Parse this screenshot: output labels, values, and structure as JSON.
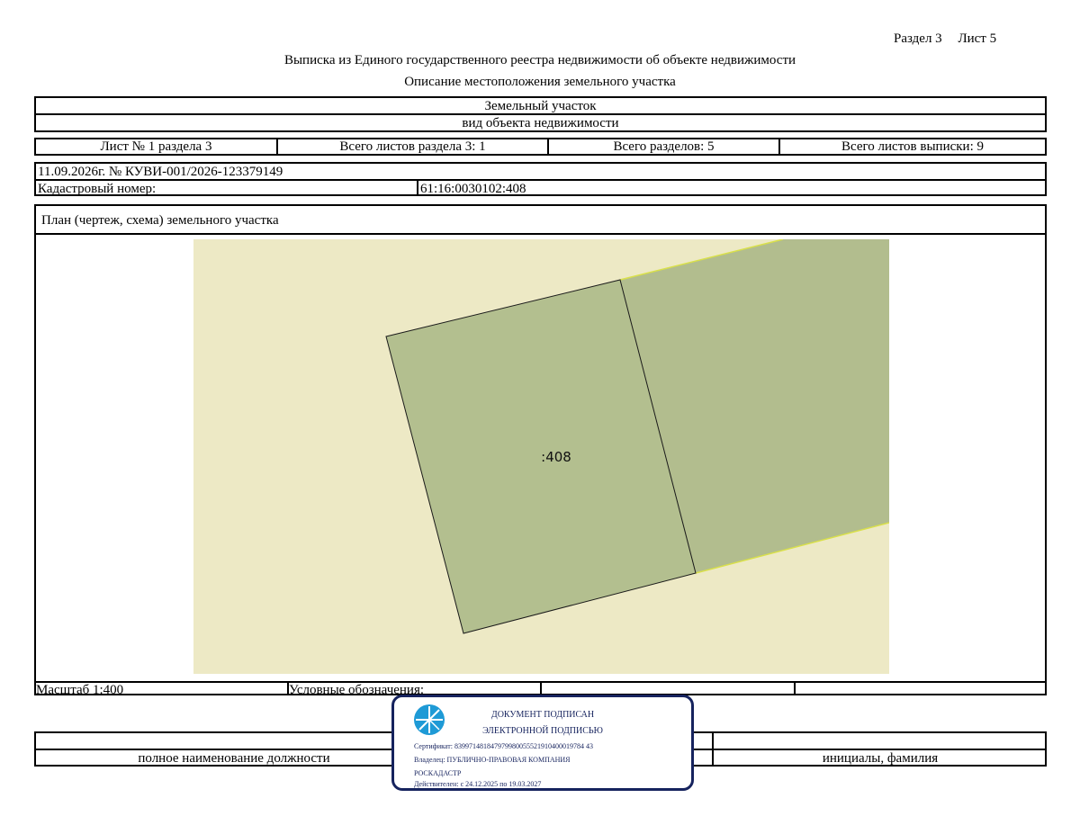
{
  "header": {
    "section_ref": "Раздел 3",
    "sheet_ref": "Лист 5",
    "title": "Выписка из Единого государственного реестра недвижимости об объекте недвижимости",
    "subtitle": "Описание местоположения земельного участка"
  },
  "object": {
    "type_value": "Земельный участок",
    "type_caption": "вид объекта недвижимости"
  },
  "sheet_info": {
    "sheet_no": "Лист № 1 раздела 3",
    "total_sheets_section": "Всего листов раздела 3: 1",
    "total_sections": "Всего разделов: 5",
    "total_sheets_extract": "Всего листов выписки: 9"
  },
  "record": {
    "date_number": "11.09.2026г. № КУВИ-001/2026-123379149",
    "cadastral_label": "Кадастровый номер:",
    "cadastral_value": "61:16:0030102:408"
  },
  "plan": {
    "title": "План (чертеж, схема) земельного участка",
    "parcel_label": ":408",
    "colors": {
      "background": "#ede9c5",
      "parcel_fill": "#b3bf8f",
      "neighbor_fill": "#b2bd8e",
      "neighbor_edge": "#d9e04a",
      "parcel_stroke": "#1a1a1a"
    }
  },
  "legend": {
    "scale": "Масштаб 1:400",
    "legend_label": "Условные обозначения:"
  },
  "signature": {
    "position_caption": "полное наименование должности",
    "name_caption": "инициалы, фамилия"
  },
  "stamp": {
    "line1": "ДОКУМЕНТ ПОДПИСАН",
    "line2": "ЭЛЕКТРОННОЙ ПОДПИСЬЮ",
    "certificate": "Сертификат: 839971481847979980055521910400019784 43",
    "owner_line1": "Владелец: ПУБЛИЧНО-ПРАВОВАЯ КОМПАНИЯ",
    "owner_line2": "РОСКАДАСТР",
    "validity": "Действителен: с 24.12.2025 по 19.03.2027",
    "color": "#16235e",
    "icon": "rosreestr-emblem-icon"
  }
}
